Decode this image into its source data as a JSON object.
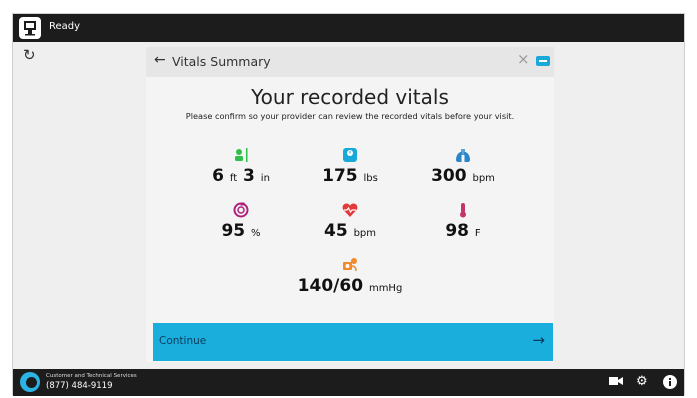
{
  "topbar": {
    "status": "Ready"
  },
  "dialog": {
    "title": "Vitals Summary",
    "heading": "Your recorded vitals",
    "subheading": "Please confirm so your provider can review the recorded vitals before your visit."
  },
  "vitals": {
    "height": {
      "ft_value": "6",
      "ft_unit": "ft",
      "in_value": "3",
      "in_unit": "in"
    },
    "weight": {
      "value": "175",
      "unit": "lbs"
    },
    "respiration": {
      "value": "300",
      "unit": "bpm"
    },
    "oxygen": {
      "value": "95",
      "unit": "%"
    },
    "heart_rate": {
      "value": "45",
      "unit": "bpm"
    },
    "temperature": {
      "value": "98",
      "unit": "F"
    },
    "blood_pressure": {
      "value": "140/60",
      "unit": "mmHg"
    }
  },
  "continue_button": {
    "label": "Continue"
  },
  "footer": {
    "support_label": "Customer and Technical Services",
    "support_phone": "(877) 484-9119"
  },
  "colors": {
    "accent": "#1aaedc",
    "height_icon": "#2fbf4a",
    "weight_icon": "#19a9d9",
    "respiration_icon": "#2a86c9",
    "oxygen_icon": "#b0207a",
    "heart_icon": "#e33a3a",
    "temperature_icon": "#c4336a",
    "bp_icon": "#f08a2a"
  },
  "icons": {
    "refresh": "refresh-icon",
    "back": "back-arrow-icon",
    "close": "close-icon",
    "keyboard": "keyboard-icon",
    "video": "video-camera-icon",
    "settings": "gear-icon",
    "info": "info-icon"
  }
}
